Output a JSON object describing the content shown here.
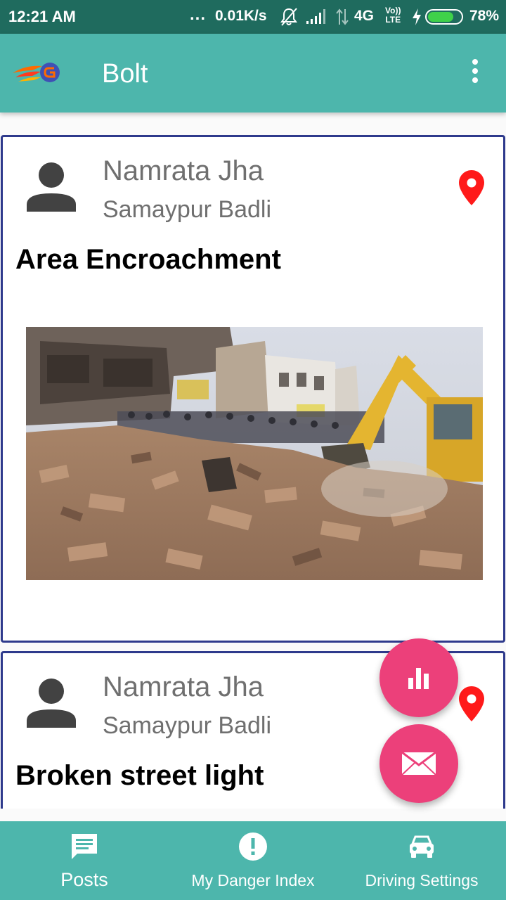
{
  "status_bar": {
    "time": "12:21 AM",
    "dots": "...",
    "speed": "0.01K/s",
    "network": "4G",
    "volte_top": "Vo))",
    "volte_bottom": "LTE",
    "battery": "78%",
    "battery_level": 0.78,
    "icons": [
      "bell-off-icon",
      "signal-icon",
      "data-arrows-icon",
      "charging-bolt-icon",
      "battery-icon"
    ]
  },
  "app_bar": {
    "title": "Bolt",
    "logo_icon": "bolt-logo-icon",
    "menu_icon": "more-vertical-icon",
    "color": "#4db6ac"
  },
  "posts": [
    {
      "author": "Namrata Jha",
      "location": "Samaypur Badli",
      "title": "Area Encroachment",
      "has_image": true,
      "image_icon": "demolition-photo"
    },
    {
      "author": "Namrata Jha",
      "location": "Samaypur Badli",
      "title": "Broken street light",
      "has_image": false
    }
  ],
  "fabs": [
    {
      "icon": "bar-chart-icon"
    },
    {
      "icon": "mail-icon"
    }
  ],
  "bottom_nav": {
    "items": [
      {
        "label": "Posts",
        "icon": "posts-icon",
        "active": true
      },
      {
        "label": "My Danger Index",
        "icon": "alert-icon",
        "active": false
      },
      {
        "label": "Driving Settings",
        "icon": "car-icon",
        "active": false
      }
    ]
  },
  "colors": {
    "status_bar": "#1f6b5e",
    "primary": "#4db6ac",
    "accent": "#ec407a",
    "card_border": "#2e3a8c",
    "pin": "#ff1a1a"
  }
}
